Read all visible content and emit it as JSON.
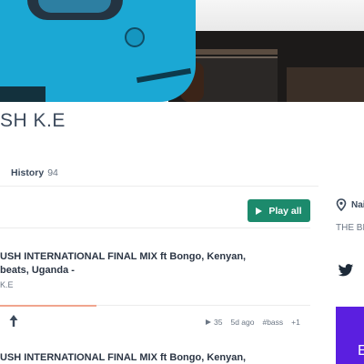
{
  "profile": {
    "name": "SH K.E"
  },
  "tabs": {
    "history_label": "History",
    "history_count": "94"
  },
  "actions": {
    "play_all_label": "Play all"
  },
  "sidebar": {
    "location": "Nai",
    "bio": "THE BE",
    "promo_text": "E"
  },
  "mixes": [
    {
      "title": "USH INTERNATIONAL FINAL MIX ft Bongo, Kenyan, beats, Uganda -",
      "owner": "K.E",
      "plays": "35",
      "age": "5d ago",
      "tag": "#bass",
      "more_tags": "+1",
      "progress": 0.31
    },
    {
      "title": "USH INTERNATIONAL FINAL MIX ft Bongo, Kenyan,"
    }
  ],
  "colors": {
    "accent_green": "#1c8a6c",
    "progress_orange": "#f0a58e",
    "promo_purple": "#5b1fe0"
  },
  "icons": {
    "location": "map-pin-icon",
    "twitter": "twitter-icon",
    "upload": "upload-arrow-icon",
    "play": "play-icon"
  }
}
